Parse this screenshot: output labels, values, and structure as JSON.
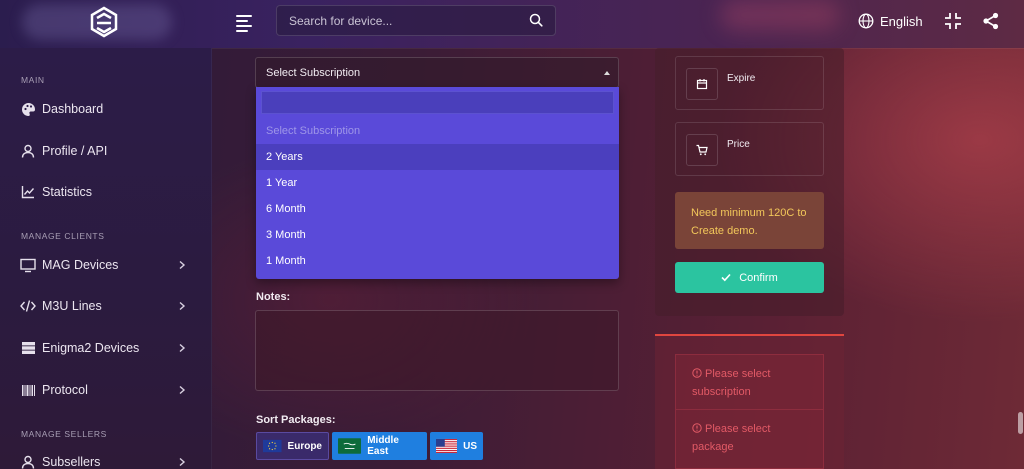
{
  "header": {
    "search_placeholder": "Search for device...",
    "language": "English"
  },
  "sidebar": {
    "sections": {
      "main": "MAIN",
      "manage_clients": "MANAGE CLIENTS",
      "manage_sellers": "MANAGE SELLERS"
    },
    "items": [
      {
        "label": "Dashboard",
        "icon": "palette-icon",
        "has_submenu": false
      },
      {
        "label": "Profile / API",
        "icon": "user-icon",
        "has_submenu": false
      },
      {
        "label": "Statistics",
        "icon": "chart-line-icon",
        "has_submenu": false
      },
      {
        "label": "MAG Devices",
        "icon": "monitor-icon",
        "has_submenu": true
      },
      {
        "label": "M3U Lines",
        "icon": "code-icon",
        "has_submenu": true
      },
      {
        "label": "Enigma2 Devices",
        "icon": "server-icon",
        "has_submenu": true
      },
      {
        "label": "Protocol",
        "icon": "barcode-icon",
        "has_submenu": true
      },
      {
        "label": "Subsellers",
        "icon": "user-icon",
        "has_submenu": true
      }
    ]
  },
  "form": {
    "subscription_select": {
      "value": "Select Subscription",
      "options": [
        {
          "label": "Select Subscription",
          "placeholder": true
        },
        {
          "label": "2 Years",
          "highlighted": true
        },
        {
          "label": "1 Year"
        },
        {
          "label": "6 Month"
        },
        {
          "label": "3 Month"
        },
        {
          "label": "1 Month"
        }
      ]
    },
    "notes_label": "Notes:",
    "sort_packages_label": "Sort Packages:",
    "packages": [
      {
        "label": "Europe",
        "color": "#3a2a6a",
        "flag": "eu-flag-icon"
      },
      {
        "label": "Middle East",
        "color": "#1f7fe0",
        "flag": "saudi-flag-icon"
      },
      {
        "label": "US",
        "color": "#1f7fe0",
        "flag": "us-flag-icon"
      }
    ]
  },
  "summary": {
    "expire_label": "Expire",
    "price_label": "Price",
    "warning": "Need minimum 120C to Create demo.",
    "confirm_label": "Confirm",
    "errors": [
      "Please select subscription",
      "Please select package"
    ]
  },
  "colors": {
    "dropdown_bg": "#5a4ad9",
    "confirm_bg": "#2bc4a0",
    "warning_text": "#f2c75a",
    "error_text": "#e25a66"
  }
}
